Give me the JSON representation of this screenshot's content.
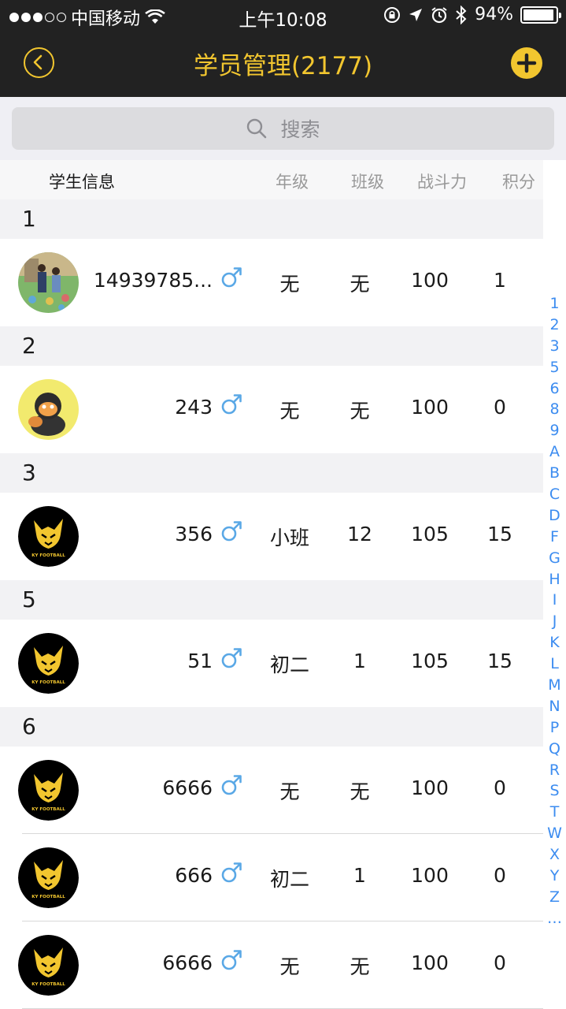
{
  "status_bar": {
    "carrier": "中国移动",
    "time": "上午10:08",
    "battery_percent": "94%",
    "battery_level": 0.94
  },
  "nav": {
    "title": "学员管理(2177)",
    "back_icon": "chevron-left-circle-icon",
    "add_icon": "plus-circle-icon",
    "accent_color": "#f2c62f"
  },
  "search": {
    "placeholder": "搜索"
  },
  "columns": {
    "info": "学生信息",
    "grade": "年级",
    "class": "班级",
    "power": "战斗力",
    "score": "积分"
  },
  "sections": [
    {
      "letter": "1",
      "rows": [
        {
          "name": "14939785...",
          "grade": "无",
          "class": "无",
          "power": "100",
          "score": "1",
          "avatar": "photo"
        }
      ]
    },
    {
      "letter": "2",
      "rows": [
        {
          "name": "243",
          "grade": "无",
          "class": "无",
          "power": "100",
          "score": "0",
          "avatar": "cartoon"
        }
      ]
    },
    {
      "letter": "3",
      "rows": [
        {
          "name": "356",
          "grade": "小班",
          "class": "12",
          "power": "105",
          "score": "15",
          "avatar": "logo"
        }
      ]
    },
    {
      "letter": "5",
      "rows": [
        {
          "name": "51",
          "grade": "初二",
          "class": "1",
          "power": "105",
          "score": "15",
          "avatar": "logo"
        }
      ]
    },
    {
      "letter": "6",
      "rows": [
        {
          "name": "6666",
          "grade": "无",
          "class": "无",
          "power": "100",
          "score": "0",
          "avatar": "logo"
        },
        {
          "name": "666",
          "grade": "初二",
          "class": "1",
          "power": "100",
          "score": "0",
          "avatar": "logo"
        },
        {
          "name": "6666",
          "grade": "无",
          "class": "无",
          "power": "100",
          "score": "0",
          "avatar": "logo"
        }
      ]
    }
  ],
  "logo_text": "KY FOOTBALL",
  "index": [
    "1",
    "2",
    "3",
    "5",
    "6",
    "8",
    "9",
    "A",
    "B",
    "C",
    "D",
    "F",
    "G",
    "H",
    "I",
    "J",
    "K",
    "L",
    "M",
    "N",
    "P",
    "Q",
    "R",
    "S",
    "T",
    "W",
    "X",
    "Y",
    "Z",
    "…"
  ]
}
